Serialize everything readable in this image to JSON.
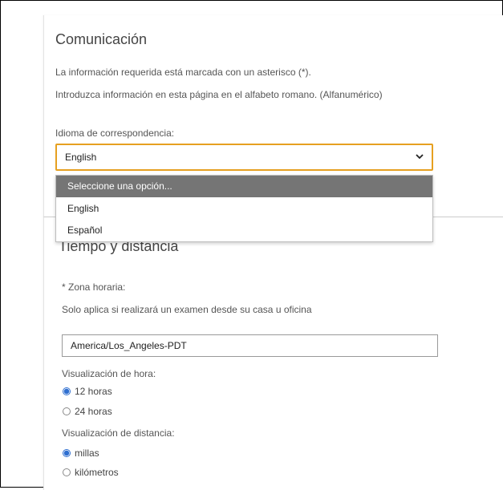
{
  "communication": {
    "title": "Comunicación",
    "required_note": "La información requerida está marcada con un asterisco (*).",
    "roman_note": "Introduzca información en esta página en el alfabeto romano. (Alfanumérico)",
    "language_label": "Idioma de correspondencia:",
    "language_select": {
      "value": "English",
      "options": [
        "Seleccione una opción...",
        "English",
        "Español"
      ],
      "highlighted_option": "Seleccione una opción..."
    }
  },
  "time_distance": {
    "title": "Tiempo y distancia",
    "timezone_label": "* Zona horaria:",
    "timezone_note": "Solo aplica si realizará un examen desde su casa u oficina",
    "timezone_value": "America/Los_Angeles-PDT",
    "time_display_label": "Visualización de hora:",
    "time_options": [
      {
        "label": "12 horas",
        "checked": true
      },
      {
        "label": "24 horas",
        "checked": false
      }
    ],
    "distance_display_label": "Visualización de distancia:",
    "distance_options": [
      {
        "label": "millas",
        "checked": true
      },
      {
        "label": "kilómetros",
        "checked": false
      }
    ]
  },
  "colors": {
    "focus_border": "#e6a020",
    "dropdown_highlight": "#757575",
    "radio_checked": "#2f6fd0"
  }
}
